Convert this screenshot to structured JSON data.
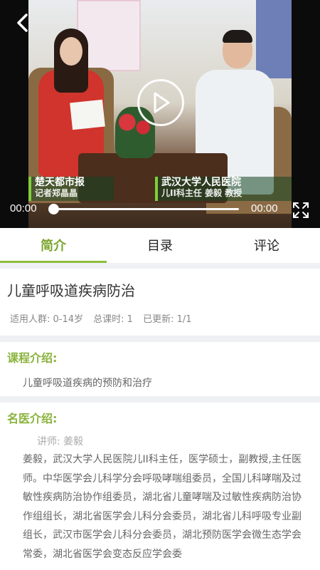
{
  "video": {
    "caption_left_line1": "楚天都市报",
    "caption_left_line2": "记者郑晶晶",
    "caption_right_line1": "武汉大学人民医院",
    "caption_right_line2": "儿II科主任  姜毅 教授",
    "current_time": "00:00",
    "duration": "00:00",
    "progress": 0
  },
  "tabs": [
    {
      "label": "简介",
      "active": true
    },
    {
      "label": "目录",
      "active": false
    },
    {
      "label": "评论",
      "active": false
    }
  ],
  "course": {
    "title": "儿童呼吸道疾病防治",
    "audience": "适用人群: 0-14岁",
    "total_lessons": "总课时: 1",
    "updated": "已更新: 1/1"
  },
  "intro": {
    "heading": "课程介绍:",
    "text": "儿童呼吸道疾病的预防和治疗"
  },
  "doctor": {
    "heading": "名医介绍:",
    "teacher": "讲师: 姜毅",
    "bio": "姜毅，武汉大学人民医院儿II科主任，医学硕士，副教授,主任医师。中华医学会儿科学分会呼吸哮喘组委员，全国儿科哮喘及过敏性疾病防治协作组委员，湖北省儿童哮喘及过敏性疾病防治协作组组长，湖北省医学会儿科分会委员，湖北省儿科呼吸专业副组长，武汉市医学会儿科分会委员，湖北预防医学会微生态学会常委，湖北省医学会变态反应学会委"
  },
  "colors": {
    "accent": "#8ab33d",
    "tab_active": "#7aa52f"
  }
}
